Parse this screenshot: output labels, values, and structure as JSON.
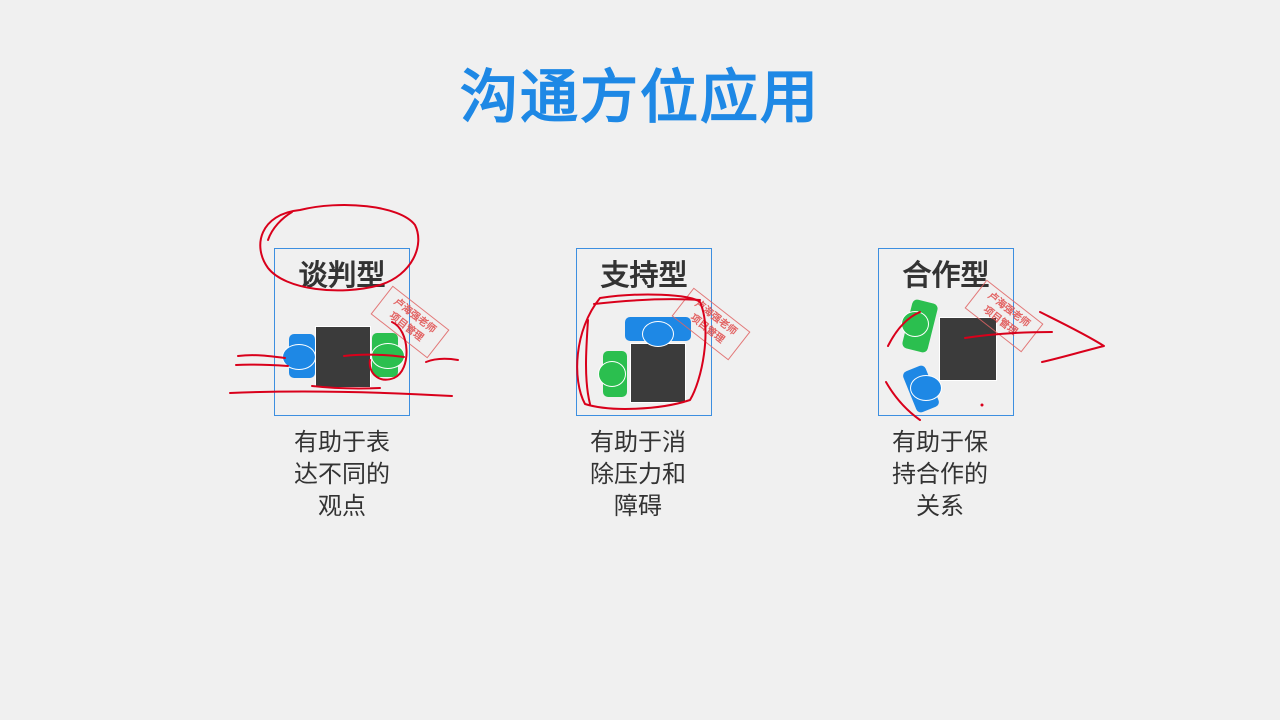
{
  "title": "沟通方位应用",
  "panels": [
    {
      "name": "谈判型",
      "caption_lines": [
        "有助于表",
        "达不同的",
        "观点"
      ]
    },
    {
      "name": "支持型",
      "caption_lines": [
        "有助于消",
        "除压力和",
        "障碍"
      ]
    },
    {
      "name": "合作型",
      "caption_lines": [
        "有助于保",
        "持合作的",
        "关系"
      ]
    }
  ],
  "stamp": {
    "line1": "卢海强老师",
    "line2": "项目管理"
  },
  "colors": {
    "title": "#1e88e5",
    "panel_border": "#3d8fe0",
    "desk": "#3b3b3b",
    "blue_person": "#1e88e5",
    "green_person": "#2bbf4f",
    "annotation_ink": "#d9001b"
  }
}
